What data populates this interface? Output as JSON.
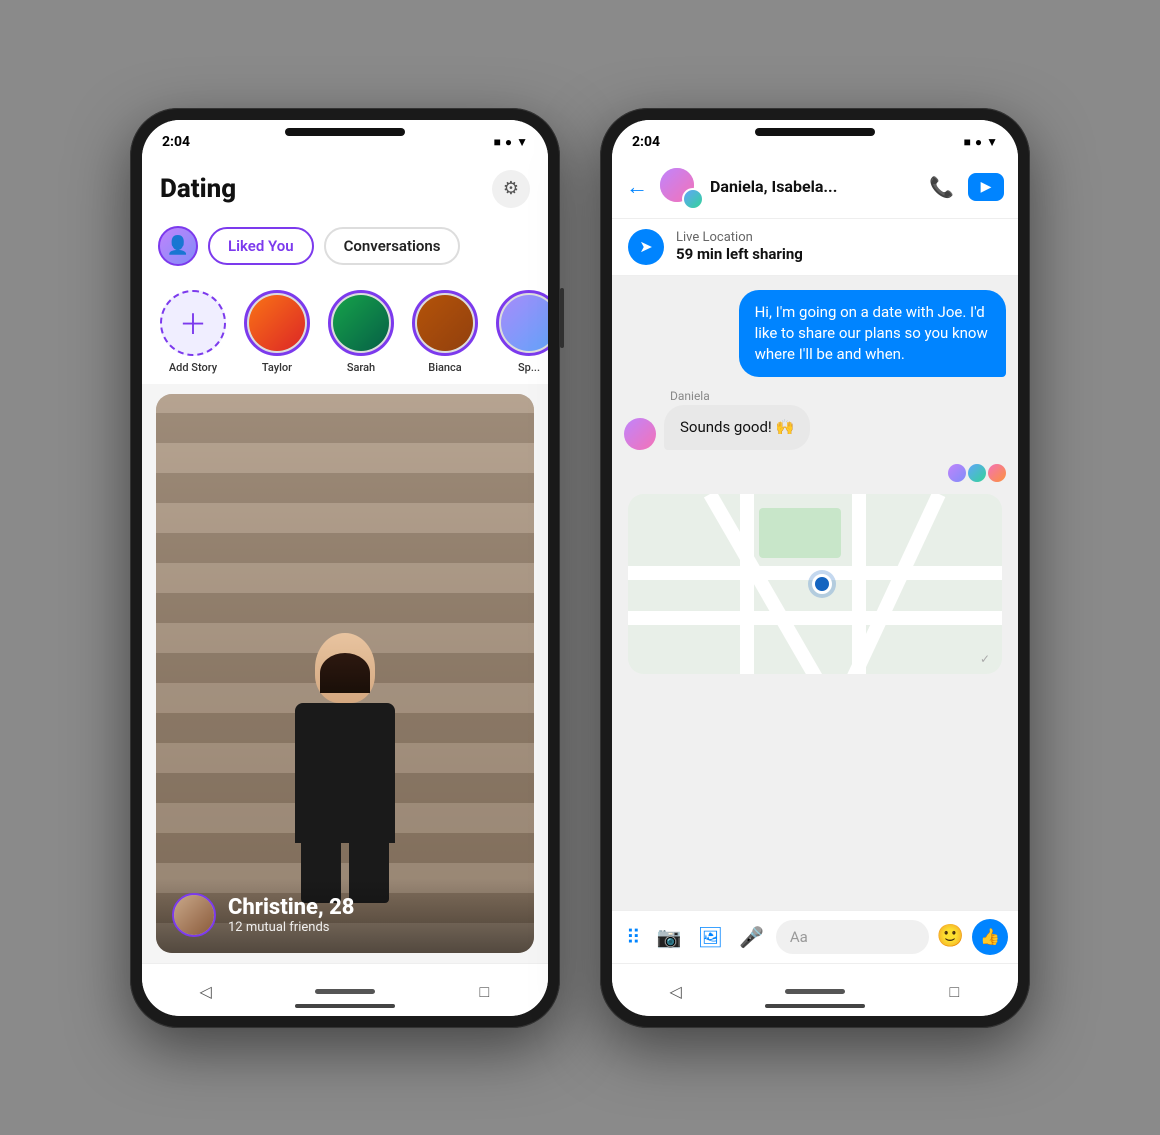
{
  "phone1": {
    "status_time": "2:04",
    "title": "Dating",
    "tab_liked": "Liked You",
    "tab_conversations": "Conversations",
    "stories": [
      {
        "label": "Add Story",
        "type": "add"
      },
      {
        "label": "Taylor",
        "type": "user"
      },
      {
        "label": "Sarah",
        "type": "user"
      },
      {
        "label": "Bianca",
        "type": "user"
      },
      {
        "label": "Sp...",
        "type": "user"
      }
    ],
    "profile_name": "Christine, 28",
    "profile_sub": "12 mutual friends"
  },
  "phone2": {
    "status_time": "2:04",
    "header_name": "Daniela, Isabela...",
    "live_location_title": "Live Location",
    "live_location_sub": "59 min left sharing",
    "messages": [
      {
        "type": "sent",
        "text": "Hi, I'm going on a date with Joe. I'd like to share our plans so you know where I'll be and when."
      },
      {
        "type": "received",
        "sender": "Daniela",
        "text": "Sounds good! 🙌"
      }
    ],
    "input_placeholder": "Aa"
  }
}
